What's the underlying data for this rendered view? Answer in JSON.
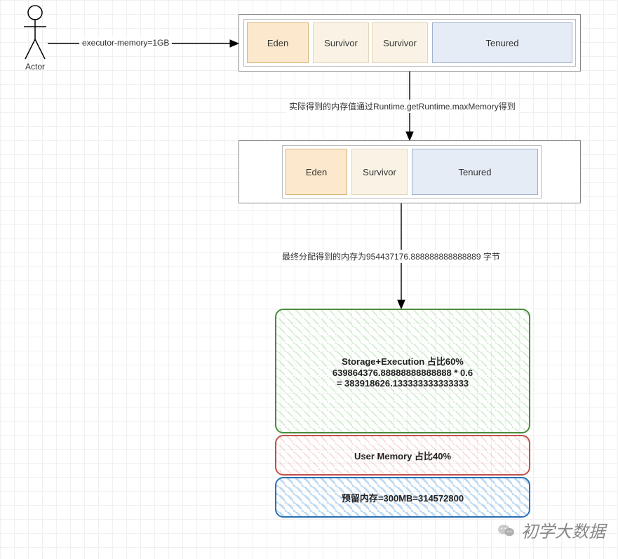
{
  "actor": {
    "label": "Actor"
  },
  "arrows": {
    "exec_label": "executor-memory=1GB",
    "runtime_label": "实际得到的内存值通过Runtime.getRuntime.maxMemory得到",
    "final_label": "最终分配得到的内存为954437176.888888888888889 字节"
  },
  "mem1": {
    "eden": "Eden",
    "survivor1": "Survivor",
    "survivor2": "Survivor",
    "tenured": "Tenured"
  },
  "mem2": {
    "eden": "Eden",
    "survivor": "Survivor",
    "tenured": "Tenured"
  },
  "alloc": {
    "green": {
      "line1": "Storage+Execution 占比60%",
      "line2": "639864376.88888888888888 * 0.6",
      "line3": "= 383918626.133333333333333"
    },
    "red": {
      "line1": "User Memory 占比40%"
    },
    "blue": {
      "line1": "预留内存=300MB=314572800"
    }
  },
  "watermark": "初学大数据"
}
